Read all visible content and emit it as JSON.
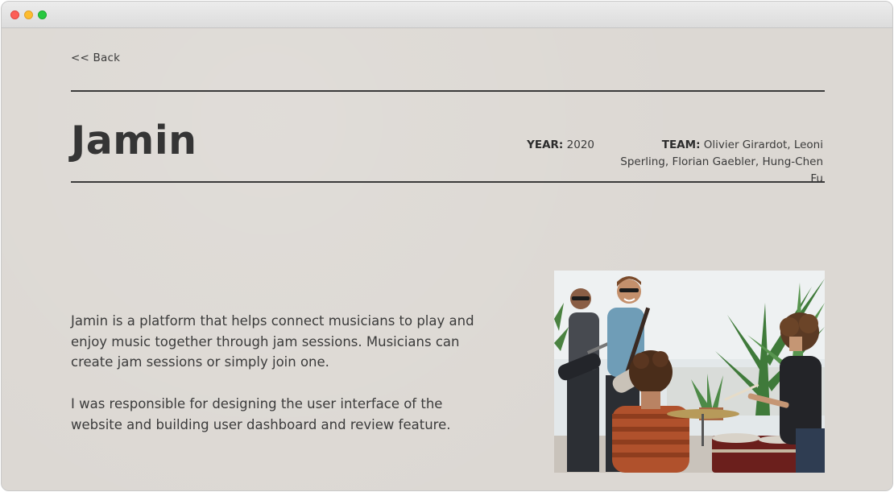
{
  "nav": {
    "back_label": "<< Back"
  },
  "project": {
    "title": "Jamin",
    "year_label": "YEAR:",
    "year": "2020",
    "team_label": "TEAM:",
    "team": "Olivier Girardot, Leoni Sperling, Florian Gaebler, Hung-Chen Fu"
  },
  "description": {
    "paragraph1": "Jamin is a platform that helps connect musicians to play and enjoy music together through jam sessions. Musicians can create jam sessions or simply join one.",
    "paragraph2": "I was responsible for designing the user interface of the website and building user dashboard and review feature."
  },
  "colors": {
    "background": "#dcd8d3",
    "text": "#3a3a3a",
    "rule": "#3a3a3a"
  }
}
